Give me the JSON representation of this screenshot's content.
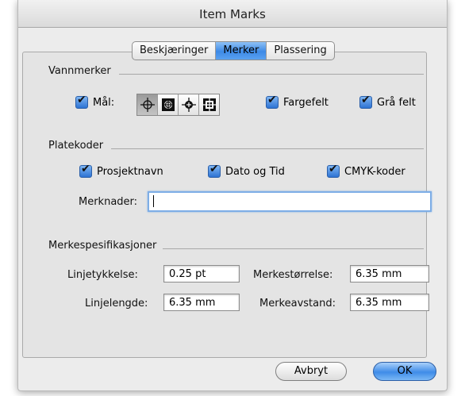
{
  "window": {
    "title": "Item Marks"
  },
  "tabs": [
    {
      "label": "Beskjæringer"
    },
    {
      "label": "Merker"
    },
    {
      "label": "Plassering"
    }
  ],
  "sections": {
    "watermarks": {
      "title": "Vannmerker"
    },
    "plate_codes": {
      "title": "Platekoder"
    },
    "mark_specs": {
      "title": "Merkespesifikasjoner"
    }
  },
  "checkboxes": {
    "targets": {
      "label": "Mål:",
      "checked": true
    },
    "color_bars": {
      "label": "Fargefelt",
      "checked": true
    },
    "gray_bars": {
      "label": "Grå felt",
      "checked": true
    },
    "project_name": {
      "label": "Prosjektnavn",
      "checked": true
    },
    "date_time": {
      "label": "Dato og Tid",
      "checked": true
    },
    "cmyk_codes": {
      "label": "CMYK-koder",
      "checked": true
    }
  },
  "target_styles": [
    "target-style-1-icon",
    "target-style-2-icon",
    "target-style-3-icon",
    "target-style-4-icon"
  ],
  "notes": {
    "label": "Merknader:",
    "value": ""
  },
  "fields": {
    "line_thickness": {
      "label": "Linjetykkelse:",
      "value": "0.25 pt"
    },
    "mark_size": {
      "label": "Merkestørrelse:",
      "value": "6.35 mm"
    },
    "line_length": {
      "label": "Linjelengde:",
      "value": "6.35 mm"
    },
    "mark_distance": {
      "label": "Merkeavstand:",
      "value": "6.35 mm"
    }
  },
  "buttons": {
    "cancel": "Avbryt",
    "ok": "OK"
  }
}
